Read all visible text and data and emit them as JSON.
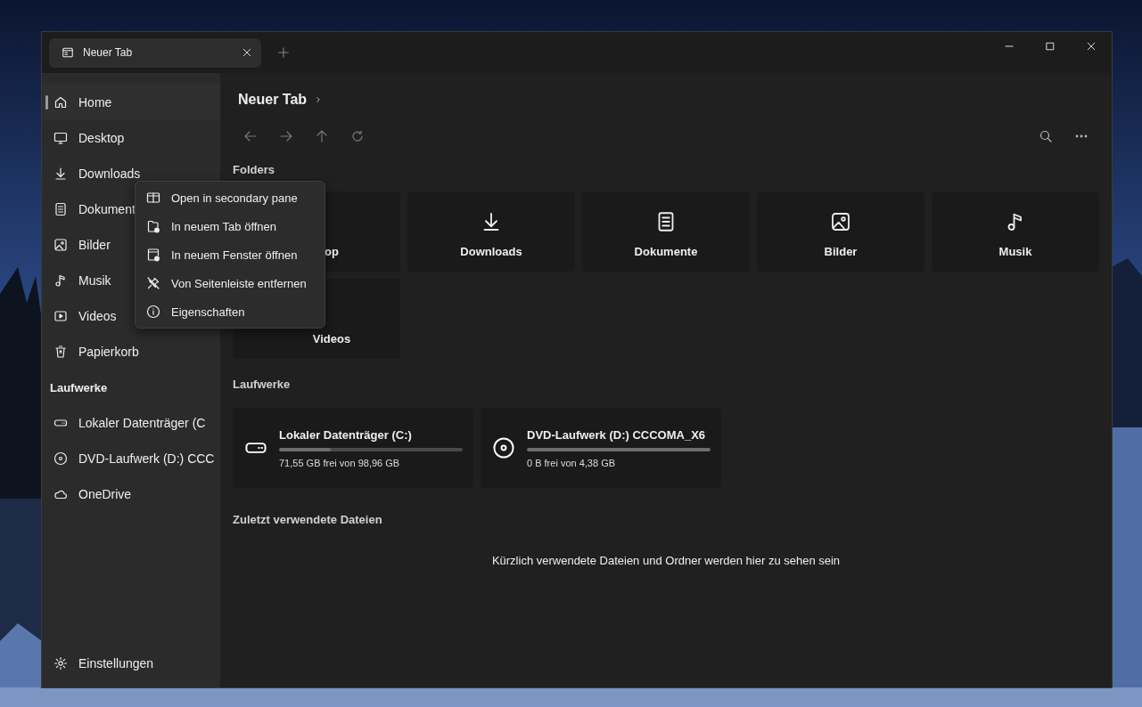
{
  "window": {
    "tabs": [
      {
        "label": "Neuer Tab",
        "selected": true
      }
    ]
  },
  "sidebar": {
    "items": [
      {
        "label": "Home",
        "selected": true
      },
      {
        "label": "Desktop",
        "selected": false
      },
      {
        "label": "Downloads",
        "selected": false
      },
      {
        "label": "Dokument",
        "selected": false
      },
      {
        "label": "Bilder",
        "selected": false
      },
      {
        "label": "Musik",
        "selected": false
      },
      {
        "label": "Videos",
        "selected": false
      },
      {
        "label": "Papierkorb",
        "selected": false
      }
    ],
    "drives_header": "Laufwerke",
    "drives": [
      {
        "label": "Lokaler Datenträger (C",
        "selected": false
      },
      {
        "label": "DVD-Laufwerk (D:) CCC",
        "selected": false
      },
      {
        "label": "OneDrive",
        "selected": false
      }
    ],
    "settings": "Einstellungen"
  },
  "main": {
    "breadcrumb": "Neuer Tab",
    "folders_header": "Folders",
    "folders": [
      {
        "label": "op"
      },
      {
        "label": "Downloads"
      },
      {
        "label": "Dokumente"
      },
      {
        "label": "Bilder"
      },
      {
        "label": "Musik"
      },
      {
        "label": "Videos"
      }
    ],
    "drives_header": "Laufwerke",
    "drives": [
      {
        "name": "Lokaler Datenträger (C:)",
        "level": 0.28,
        "reading": "71,55 GB frei von 98,96 GB"
      },
      {
        "name": "DVD-Laufwerk (D:) CCCOMA_X6",
        "level": 1,
        "reading": "0 B frei von 4,38 GB"
      }
    ],
    "recent_header": "Zuletzt verwendete Dateien",
    "recent_empty": "Kürzlich verwendete Dateien und Ordner werden hier zu sehen sein"
  },
  "context_menu": {
    "items": [
      {
        "label": "Open in secondary pane"
      },
      {
        "label": "In neuem Tab öffnen"
      },
      {
        "label": "In neuem Fenster öffnen"
      },
      {
        "label": "Von Seitenleiste entfernen"
      },
      {
        "label": "Eigenschaften"
      }
    ]
  }
}
